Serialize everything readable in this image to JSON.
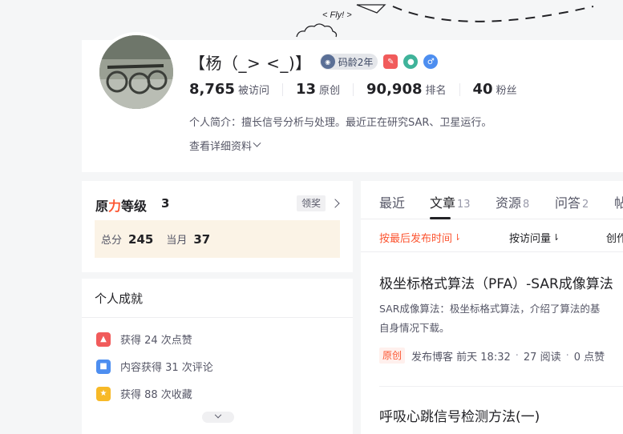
{
  "banner": {
    "fly_text": "< Fly! >"
  },
  "profile": {
    "name": "【杨（_> <_)】",
    "code_age": "码龄2年",
    "stats": [
      {
        "value": "8,765",
        "label": "被访问"
      },
      {
        "value": "13",
        "label": "原创"
      },
      {
        "value": "90,908",
        "label": "排名"
      },
      {
        "value": "40",
        "label": "粉丝"
      }
    ],
    "intro": "个人简介：擅长信号分析与处理。最近正在研究SAR、卫星运行。",
    "more_label": "查看详细资料"
  },
  "level": {
    "title_a": "原",
    "title_b": "力",
    "title_c": "等级",
    "value": "3",
    "claim_label": "领奖",
    "total_label": "总分",
    "total_value": "245",
    "month_label": "当月",
    "month_value": "37"
  },
  "achievements": {
    "title": "个人成就",
    "items": [
      {
        "text": "获得 24 次点赞",
        "color": "#f15b5b"
      },
      {
        "text": "内容获得 31 次评论",
        "color": "#4d8ef0"
      },
      {
        "text": "获得 88 次收藏",
        "color": "#f7b927"
      }
    ]
  },
  "tabs": [
    {
      "label": "最近",
      "count": ""
    },
    {
      "label": "文章",
      "count": "13"
    },
    {
      "label": "资源",
      "count": "8"
    },
    {
      "label": "问答",
      "count": "2"
    },
    {
      "label": "帖",
      "count": ""
    }
  ],
  "sorts": [
    {
      "label": "按最后发布时间",
      "arrow": "⇂"
    },
    {
      "label": "按访问量",
      "arrow": "⇂"
    },
    {
      "label": "创作",
      "arrow": ""
    }
  ],
  "articles": [
    {
      "title": "极坐标格式算法（PFA）-SAR成像算法",
      "desc_line1": "SAR成像算法：极坐标格式算法，介绍了算法的基",
      "desc_line2": "自身情况下载。",
      "tag": "原创",
      "publish": "发布博客 前天 18:32",
      "reads": "27 阅读",
      "likes": "0 点赞"
    },
    {
      "title": "呼吸心跳信号检测方法(一)"
    }
  ],
  "colors": {
    "accent": "#fc5531",
    "level_bg": "#fbf3e6"
  }
}
